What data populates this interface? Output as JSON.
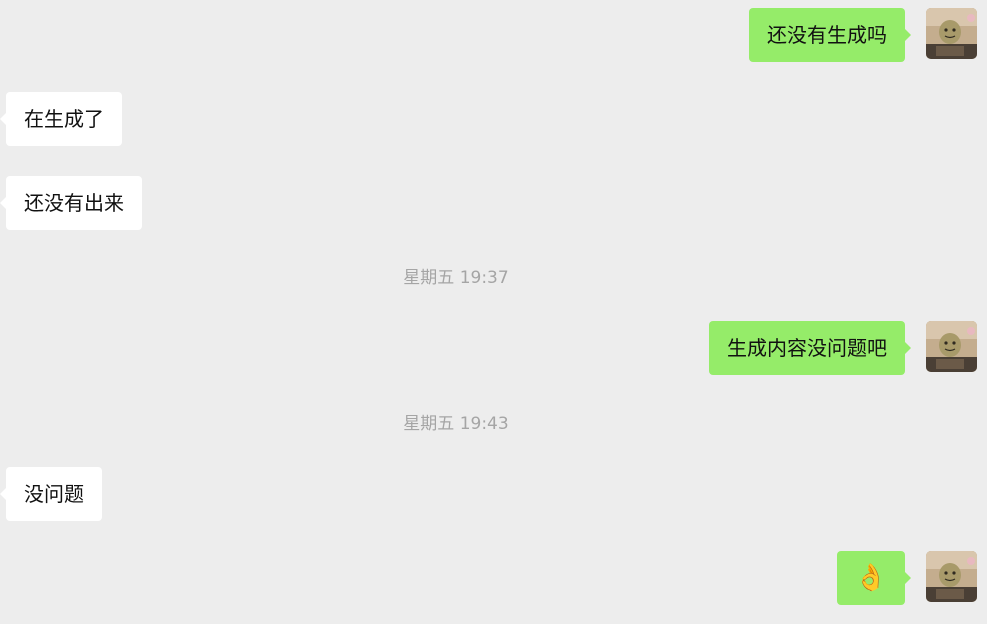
{
  "messages": [
    {
      "direction": "out",
      "text": "还没有生成吗"
    },
    {
      "direction": "in",
      "text": "在生成了"
    },
    {
      "direction": "in",
      "text": "还没有出来"
    },
    {
      "type": "timestamp",
      "text": "星期五 19:37"
    },
    {
      "direction": "out",
      "text": "生成内容没问题吧"
    },
    {
      "type": "timestamp",
      "text": "星期五 19:43"
    },
    {
      "direction": "in",
      "text": "没问题"
    },
    {
      "direction": "out",
      "text": "👌"
    }
  ],
  "colors": {
    "background": "#ededed",
    "outgoing_bubble": "#95ec69",
    "incoming_bubble": "#ffffff",
    "timestamp_text": "#a5a5a5"
  }
}
